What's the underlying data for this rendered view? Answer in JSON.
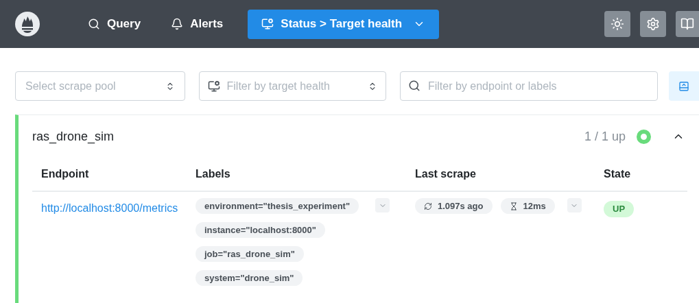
{
  "nav": [
    {
      "label": "Query",
      "selected": false
    },
    {
      "label": "Alerts",
      "selected": false
    },
    {
      "label": "Status > Target health",
      "selected": true
    }
  ],
  "filters": {
    "pool": {
      "placeholder": "Select scrape pool"
    },
    "health": {
      "placeholder": "Filter by target health"
    },
    "search": {
      "placeholder": "Filter by endpoint or labels"
    }
  },
  "pools": [
    {
      "name": "ras_drone_sim",
      "summary": "1 / 1 up",
      "color": "#69db7c",
      "expanded": true,
      "columns": [
        "Endpoint",
        "Labels",
        "Last scrape",
        "State"
      ],
      "rows": [
        {
          "endpoint": "http://localhost:8000/metrics",
          "labels": [
            "environment=\"thesis_experiment\"",
            "instance=\"localhost:8000\"",
            "job=\"ras_drone_sim\"",
            "system=\"drone_sim\""
          ],
          "last_scrape": "1.097s ago",
          "duration": "12ms",
          "state": "UP"
        }
      ]
    }
  ]
}
